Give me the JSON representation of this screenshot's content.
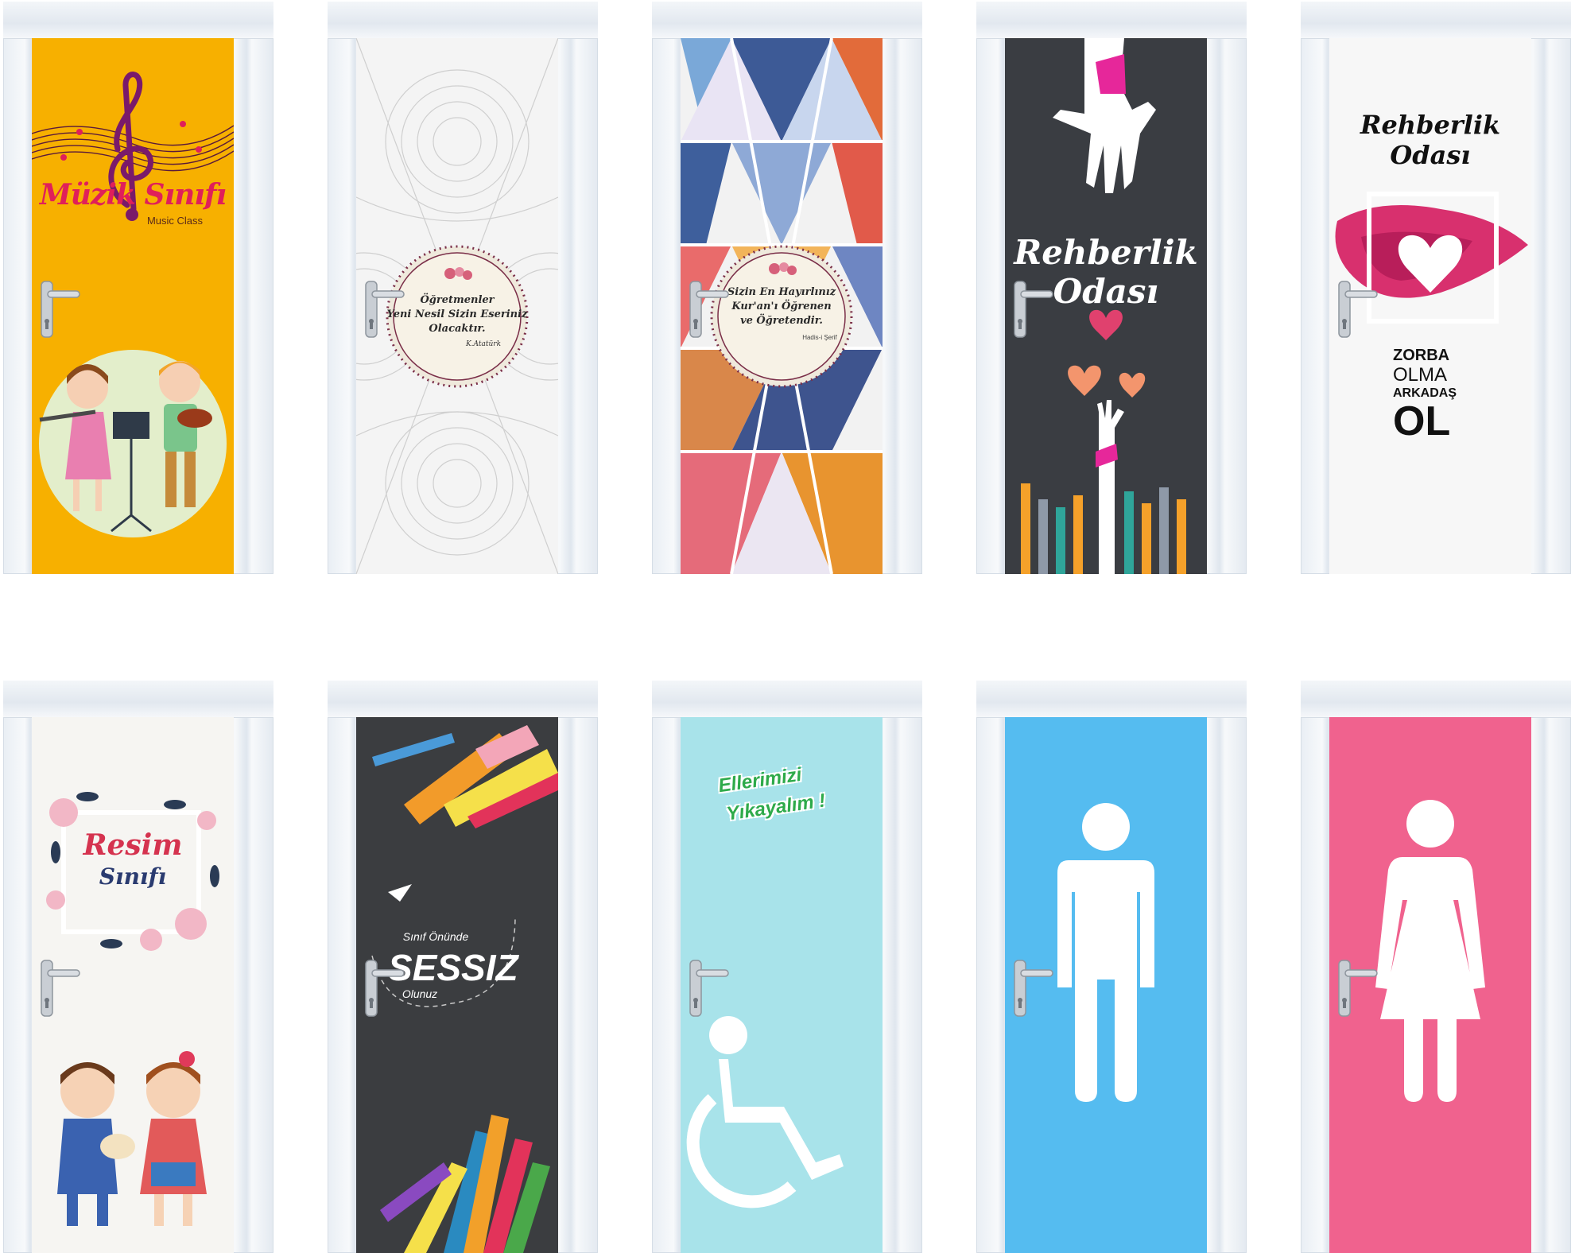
{
  "doors": {
    "muzik": {
      "title": "Müzik Sınıfı",
      "subtitle": "Music Class",
      "color": "#f7b000"
    },
    "ogretmenler": {
      "quote_line1": "Öğretmenler",
      "quote_line2": "Yeni Nesil Sizin Eseriniz",
      "quote_line3": "Olacaktır.",
      "signature": "K.Atatürk"
    },
    "kuran": {
      "quote_line1": "Sizin En Hayırlınız",
      "quote_line2": "Kur'an'ı Öğrenen",
      "quote_line3": "ve Öğretendir.",
      "source": "Hadis-i Şerif"
    },
    "rehberlik1": {
      "title_line1": "Rehberlik",
      "title_line2": "Odası",
      "color": "#3a3d42"
    },
    "rehberlik2": {
      "title_line1": "Rehberlik",
      "title_line2": "Odası",
      "slogan1": "ZORBA",
      "slogan2": "OLMA",
      "slogan3": "ARKADAŞ",
      "slogan4": "OL"
    },
    "resim": {
      "title_line1": "Resim",
      "title_line2": "Sınıfı"
    },
    "sessiz": {
      "line1": "Sınıf Önünde",
      "line2": "SESSIZ",
      "line3": "Olunuz"
    },
    "yikayalim": {
      "line1": "Ellerimizi",
      "line2": "Yıkayalım !",
      "color": "#a8e3ea"
    },
    "erkek": {
      "color": "#55bcf0",
      "icon": "man-icon"
    },
    "kadin": {
      "color": "#f0628e",
      "icon": "woman-icon"
    }
  }
}
